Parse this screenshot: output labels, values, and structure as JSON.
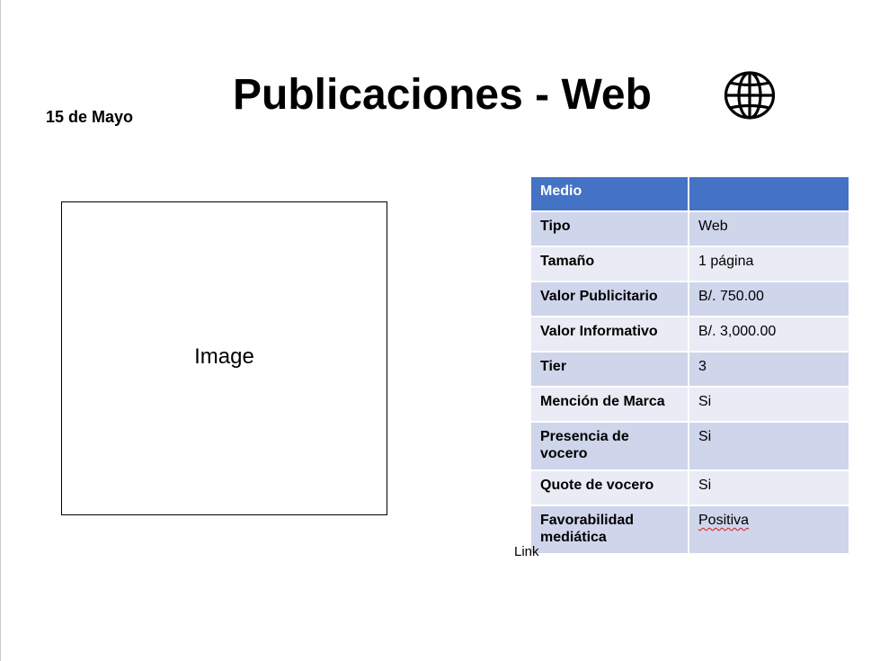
{
  "slide": {
    "title": "Publicaciones - Web",
    "date": "15 de Mayo",
    "image_label": "Image",
    "link_label": "Link",
    "icon": "globe-icon"
  },
  "table": {
    "header": {
      "key": "Medio",
      "value": ""
    },
    "rows": [
      {
        "key": "Tipo",
        "value": "Web"
      },
      {
        "key": "Tamaño",
        "value": "1 página"
      },
      {
        "key": "Valor Publicitario",
        "value": "B/. 750.00"
      },
      {
        "key": "Valor Informativo",
        "value": "B/. 3,000.00"
      },
      {
        "key": "Tier",
        "value": "3"
      },
      {
        "key": "Mención de Marca",
        "value": "Si"
      },
      {
        "key": "Presencia de vocero",
        "value": "Si"
      },
      {
        "key": "Quote de vocero",
        "value": "Si"
      },
      {
        "key": "Favorabilidad mediática",
        "value": "Positiva"
      }
    ]
  },
  "colors": {
    "header_blue": "#4472c4",
    "row_dark": "#cfd5ea",
    "row_light": "#e9ebf5",
    "spellcheck_underline": "#d01c1c"
  }
}
